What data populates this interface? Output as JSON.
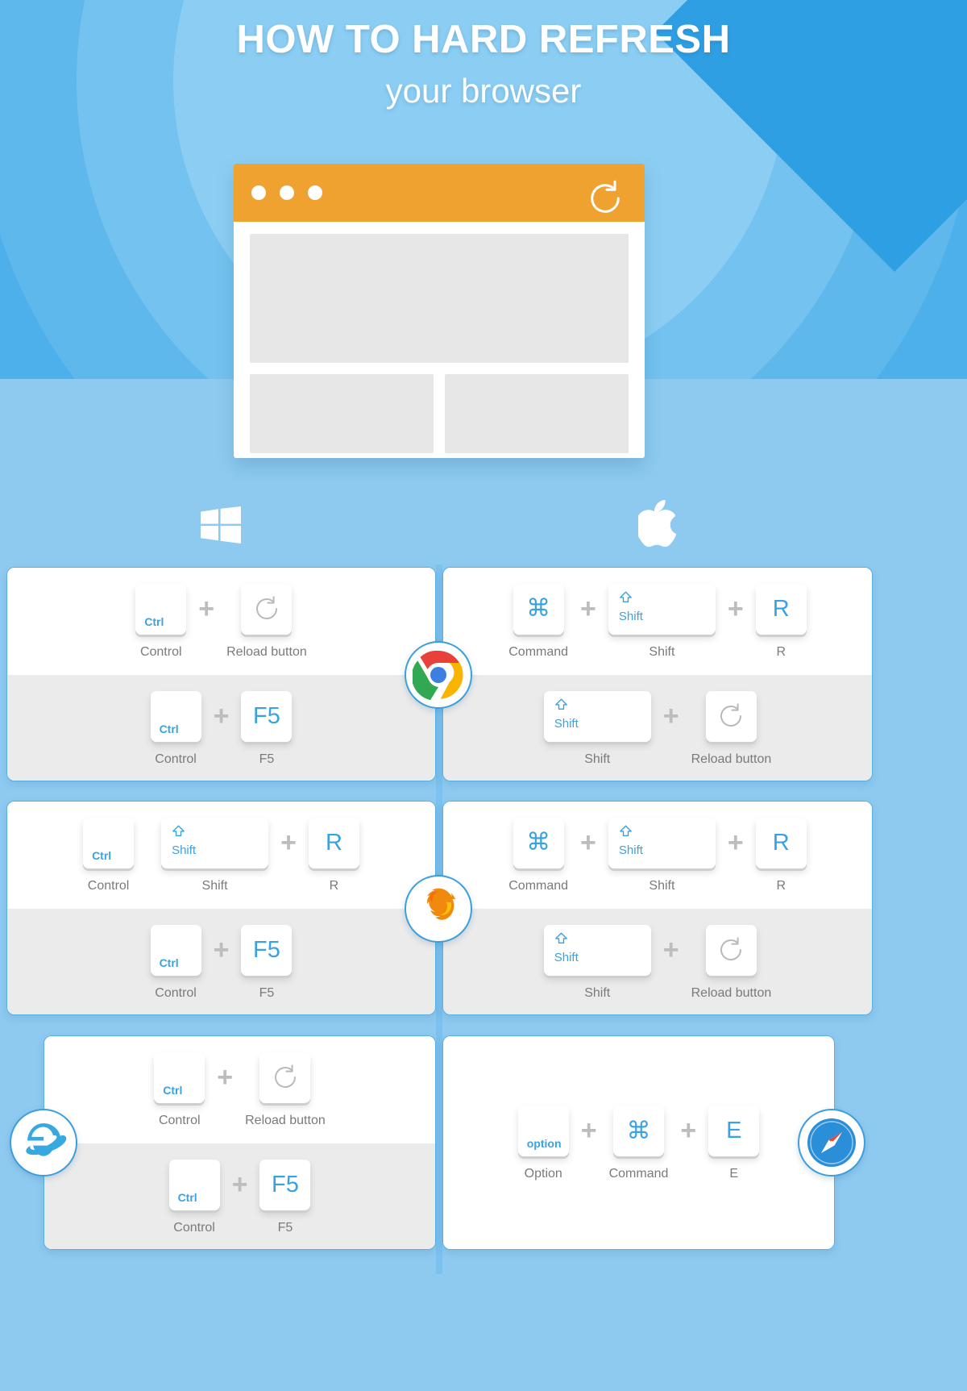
{
  "header": {
    "title_main": "HOW TO HARD REFRESH",
    "title_sub": "your browser"
  },
  "browser_mockup": {
    "dots": [
      "dot-1",
      "dot-2",
      "dot-3"
    ],
    "reload_icon_name": "reload-icon"
  },
  "platforms": {
    "windows_label": "Windows",
    "mac_label": "macOS"
  },
  "colors": {
    "hero_blue": "#3ca7e8",
    "page_blue": "#8ecaf0",
    "accent_blue": "#3ba2e0",
    "orange": "#f0a230",
    "card_border": "#58b0e4",
    "row_alt": "#ebebeb",
    "caption_gray": "#7a7a7a",
    "plus_gray": "#bdbdbd"
  },
  "browsers": [
    {
      "name": "Chrome",
      "icon": "chrome-icon",
      "windows": {
        "top": [
          {
            "type": "corner",
            "key": "Ctrl",
            "caption": "Control"
          },
          {
            "type": "plus"
          },
          {
            "type": "reload",
            "key": "",
            "caption": "Reload button"
          }
        ],
        "bottom": [
          {
            "type": "corner",
            "key": "Ctrl",
            "caption": "Control"
          },
          {
            "type": "plus"
          },
          {
            "type": "letter",
            "key": "F5",
            "caption": "F5"
          }
        ]
      },
      "mac": {
        "top": [
          {
            "type": "glyph",
            "key": "⌘",
            "caption": "Command"
          },
          {
            "type": "plus"
          },
          {
            "type": "shift",
            "key": "Shift",
            "caption": "Shift"
          },
          {
            "type": "plus"
          },
          {
            "type": "letter",
            "key": "R",
            "caption": "R"
          }
        ],
        "bottom": [
          {
            "type": "shift",
            "key": "Shift",
            "caption": "Shift"
          },
          {
            "type": "plus"
          },
          {
            "type": "reload",
            "key": "",
            "caption": "Reload button"
          }
        ]
      }
    },
    {
      "name": "Firefox",
      "icon": "firefox-icon",
      "windows": {
        "top": [
          {
            "type": "corner",
            "key": "Ctrl",
            "caption": "Control"
          },
          {
            "type": "gap"
          },
          {
            "type": "shift",
            "key": "Shift",
            "caption": "Shift"
          },
          {
            "type": "plus"
          },
          {
            "type": "letter",
            "key": "R",
            "caption": "R"
          }
        ],
        "bottom": [
          {
            "type": "corner",
            "key": "Ctrl",
            "caption": "Control"
          },
          {
            "type": "plus"
          },
          {
            "type": "letter",
            "key": "F5",
            "caption": "F5"
          }
        ]
      },
      "mac": {
        "top": [
          {
            "type": "glyph",
            "key": "⌘",
            "caption": "Command"
          },
          {
            "type": "plus"
          },
          {
            "type": "shift",
            "key": "Shift",
            "caption": "Shift"
          },
          {
            "type": "plus"
          },
          {
            "type": "letter",
            "key": "R",
            "caption": "R"
          }
        ],
        "bottom": [
          {
            "type": "shift",
            "key": "Shift",
            "caption": "Shift"
          },
          {
            "type": "plus"
          },
          {
            "type": "reload",
            "key": "",
            "caption": "Reload button"
          }
        ]
      }
    },
    {
      "name": "Internet Explorer",
      "icon": "internet-explorer-icon",
      "windows": {
        "top": [
          {
            "type": "corner",
            "key": "Ctrl",
            "caption": "Control"
          },
          {
            "type": "plus"
          },
          {
            "type": "reload",
            "key": "",
            "caption": "Reload button"
          }
        ],
        "bottom": [
          {
            "type": "corner",
            "key": "Ctrl",
            "caption": "Control"
          },
          {
            "type": "plus"
          },
          {
            "type": "letter",
            "key": "F5",
            "caption": "F5"
          }
        ]
      }
    },
    {
      "name": "Safari",
      "icon": "safari-icon",
      "mac": {
        "top": [
          {
            "type": "corner",
            "key": "option",
            "caption": "Option"
          },
          {
            "type": "plus"
          },
          {
            "type": "glyph",
            "key": "⌘",
            "caption": "Command"
          },
          {
            "type": "plus"
          },
          {
            "type": "letter",
            "key": "E",
            "caption": "E"
          }
        ]
      }
    }
  ]
}
